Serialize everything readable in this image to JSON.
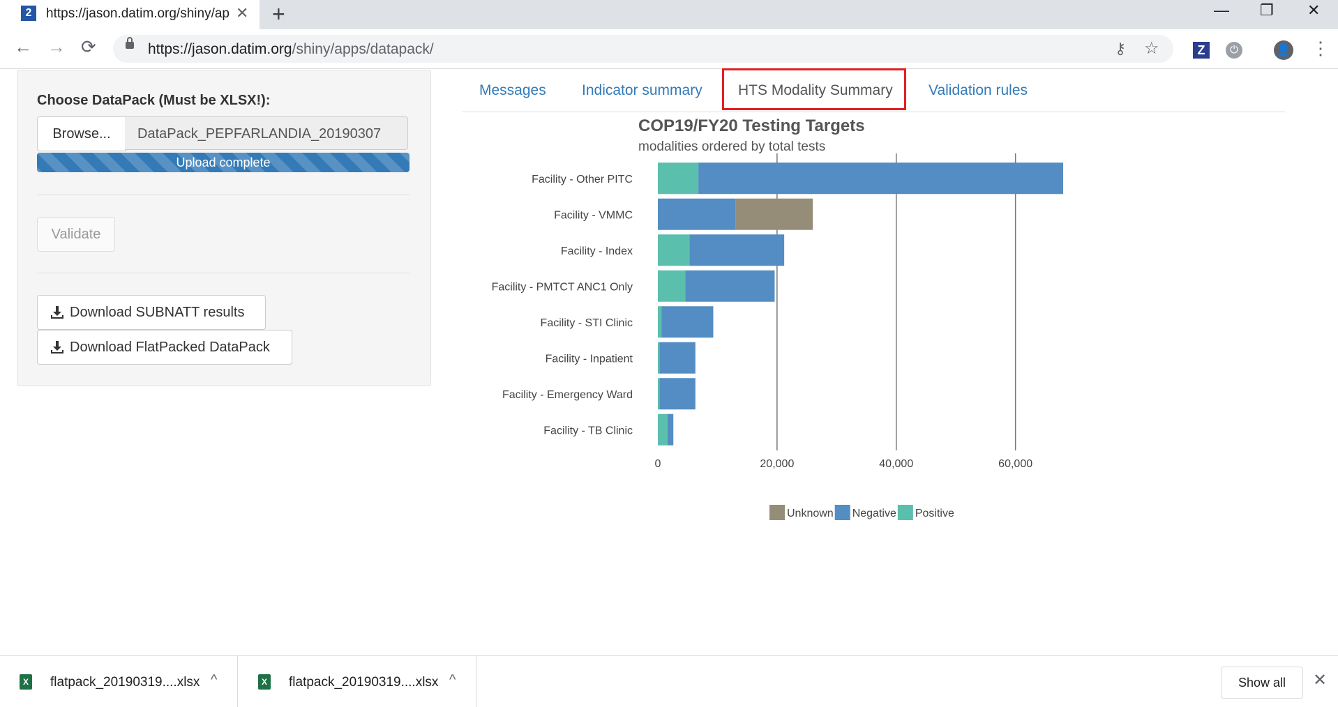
{
  "browser": {
    "tab_icon_text": "2",
    "tab_title": "https://jason.datim.org/shiny/apps/datapack/",
    "tab_close": "✕",
    "new_tab": "+",
    "url_host": "https://jason.datim.org",
    "url_path": "/shiny/apps/datapack/",
    "window_minimize": "—",
    "window_restore": "❐",
    "window_close": "✕",
    "back": "←",
    "forward": "→",
    "reload": "⟳",
    "key_icon": "⚷",
    "star_icon": "☆",
    "ext_z": "Z",
    "ext_power": "⏻",
    "profile": "👤",
    "menu": "⋮"
  },
  "sidebar": {
    "choose_label": "Choose DataPack (Must be XLSX!):",
    "browse_label": "Browse...",
    "file_name": "DataPack_PEPFARLANDIA_20190307",
    "upload_status": "Upload complete",
    "validate_label": "Validate",
    "download_subnatt": "Download SUBNATT results",
    "download_flatpack": "Download FlatPacked DataPack"
  },
  "tabs": [
    {
      "label": "Messages"
    },
    {
      "label": "Indicator summary"
    },
    {
      "label": "HTS Modality Summary",
      "active": true
    },
    {
      "label": "Validation rules"
    }
  ],
  "chart_data": {
    "type": "bar",
    "orientation": "horizontal",
    "stacked": true,
    "title": "COP19/FY20 Testing Targets",
    "subtitle": "modalities ordered by total tests",
    "categories": [
      "Facility - Other PITC",
      "Facility - VMMC",
      "Facility - Index",
      "Facility - PMTCT ANC1 Only",
      "Facility - STI Clinic",
      "Facility - Inpatient",
      "Facility - Emergency Ward",
      "Facility - TB Clinic"
    ],
    "series": [
      {
        "name": "Positive",
        "color": "#5bbfad",
        "values": [
          6800,
          0,
          5300,
          4600,
          600,
          300,
          300,
          1600
        ]
      },
      {
        "name": "Negative",
        "color": "#538dc3",
        "values": [
          61200,
          13000,
          15900,
          15000,
          8700,
          6000,
          6000,
          1000
        ]
      },
      {
        "name": "Unknown",
        "color": "#968d79",
        "values": [
          0,
          13000,
          0,
          0,
          0,
          0,
          0,
          0
        ]
      }
    ],
    "legend_order": [
      "Unknown",
      "Negative",
      "Positive"
    ],
    "xlim": [
      0,
      68000
    ],
    "xticks": [
      0,
      20000,
      40000,
      60000
    ],
    "xtick_labels": [
      "0",
      "20,000",
      "40,000",
      "60,000"
    ],
    "grid": true,
    "legend_position": "bottom"
  },
  "downloads": {
    "items": [
      {
        "file": "flatpack_20190319....xlsx",
        "caret": "^"
      },
      {
        "file": "flatpack_20190319....xlsx",
        "caret": "^"
      }
    ],
    "show_all": "Show all",
    "close": "✕"
  }
}
